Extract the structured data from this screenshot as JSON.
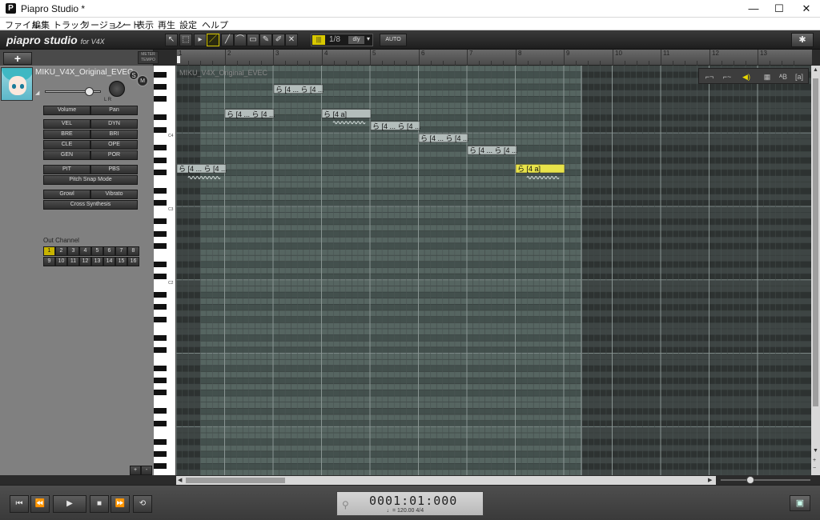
{
  "window": {
    "title": "Piapro Studio *",
    "controls": {
      "minimize": "—",
      "maximize": "☐",
      "close": "✕"
    }
  },
  "menu": [
    "ファイル",
    "編集",
    "トラック",
    "リージョン",
    "ノート",
    "表示",
    "再生",
    "設定",
    "ヘルプ"
  ],
  "toolbar": {
    "logo": "piapro studio",
    "logo_suffix": "for V4X",
    "tools": [
      "pointer-tool",
      "select-tool",
      "draw-tool",
      "line-tool",
      "curve-tool",
      "eraser-tool",
      "marker-tool",
      "mute-tool",
      "split-tool"
    ],
    "quantize_value": "1/8",
    "quantize_label": "dly",
    "quantize_arrow": "▾",
    "auto_label": "AUTO",
    "settings_icon": "✱"
  },
  "left_panel": {
    "add_track": "+",
    "meter_tempo": "METER TEMPO",
    "singer": "MIKU_V4X_Original_EVEC",
    "solo": "S",
    "mute": "M",
    "pan_marks": "L    R",
    "param_buttons": [
      {
        "label": "Volume",
        "right": "Pan"
      },
      {
        "label": "VEL",
        "right": "DYN"
      },
      {
        "label": "BRE",
        "right": "BRI"
      },
      {
        "label": "CLE",
        "right": "OPE"
      },
      {
        "label": "GEN",
        "right": "POR"
      },
      {
        "label": "PIT",
        "right": "PBS"
      }
    ],
    "pitch_snap": "Pitch Snap Mode",
    "growl": "Growl",
    "vibrato": "Vibrato",
    "cross_synthesis": "Cross Synthesis",
    "out_channel_label": "Out Channel",
    "channels": [
      "1",
      "2",
      "3",
      "4",
      "5",
      "6",
      "7",
      "8",
      "9",
      "10",
      "11",
      "12",
      "13",
      "14",
      "15",
      "16"
    ],
    "active_channel": "1",
    "footer_btns": [
      "+",
      "-"
    ]
  },
  "piano": {
    "c_labels": [
      "C4",
      "C3",
      "C2"
    ]
  },
  "ruler": {
    "measures": [
      "1",
      "2",
      "3",
      "4",
      "5",
      "6",
      "7",
      "8",
      "9",
      "10",
      "11",
      "12",
      "13"
    ]
  },
  "editor": {
    "track_label": "MIKU_V4X_Original_EVEC",
    "notes": [
      {
        "label": "ら [4 ... ら [4 ...",
        "bar": 2,
        "measure_start": 1.0,
        "measure_len": 1.0
      },
      {
        "label": "ら [4 ... ら [4 ...",
        "bar": 3,
        "measure_start": 2.0,
        "measure_len": 1.0
      },
      {
        "label": "ら [4 ... ら [4 ...",
        "bar": 1,
        "measure_start": 3.0,
        "measure_len": 1.0
      },
      {
        "label": "ら [4 a]",
        "bar": 3,
        "measure_start": 4.0,
        "measure_len": 1.0
      },
      {
        "label": "ら [4 ... ら [4 ...",
        "bar": 4,
        "measure_start": 5.0,
        "measure_len": 1.0
      },
      {
        "label": "ら [4 ... ら [4 ...",
        "bar": 5,
        "measure_start": 6.0,
        "measure_len": 1.0
      },
      {
        "label": "ら [4 ... ら [4 ...",
        "bar": 6,
        "measure_start": 7.0,
        "measure_len": 1.0
      },
      {
        "label": "ら [4 a]",
        "bar": 7,
        "measure_start": 8.0,
        "measure_len": 1.0,
        "selected": true
      }
    ]
  },
  "view_controls": [
    "step-icon",
    "curve-icon",
    "speaker-icon",
    "grid-icon",
    "ab-icon",
    "a-bracket-icon"
  ],
  "transport": {
    "buttons": [
      "⏮",
      "⏪",
      "▶",
      "■",
      "⏩",
      "⟲"
    ],
    "position": "0001:01:000",
    "tempo": "♩= 120.00  4/4",
    "link_icon": "⚲",
    "image_icon": "▣"
  },
  "colors": {
    "selected_note": "#e8e34a",
    "note": "#b3bdbb",
    "accent": "#d8c800"
  }
}
